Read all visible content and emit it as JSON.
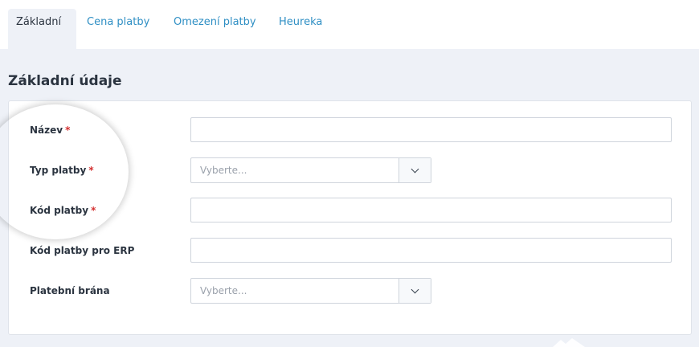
{
  "tabs": [
    {
      "label": "Základní",
      "active": true
    },
    {
      "label": "Cena platby",
      "active": false
    },
    {
      "label": "Omezení platby",
      "active": false
    },
    {
      "label": "Heureka",
      "active": false
    }
  ],
  "section": {
    "title": "Základní údaje"
  },
  "form": {
    "required_mark": "*",
    "fields": [
      {
        "label": "Název",
        "required": true,
        "type": "text",
        "value": ""
      },
      {
        "label": "Typ platby",
        "required": true,
        "type": "select",
        "placeholder": "Vyberte..."
      },
      {
        "label": "Kód platby",
        "required": true,
        "type": "text",
        "value": ""
      },
      {
        "label": "Kód platby pro ERP",
        "required": false,
        "type": "text",
        "value": ""
      },
      {
        "label": "Platební brána",
        "required": false,
        "type": "select",
        "placeholder": "Vyberte..."
      }
    ]
  },
  "colors": {
    "link": "#2f8fc4",
    "required": "#d32f2f",
    "page_bg": "#eef1f7"
  },
  "icons": {
    "select_toggle": "chevron-down-icon"
  }
}
